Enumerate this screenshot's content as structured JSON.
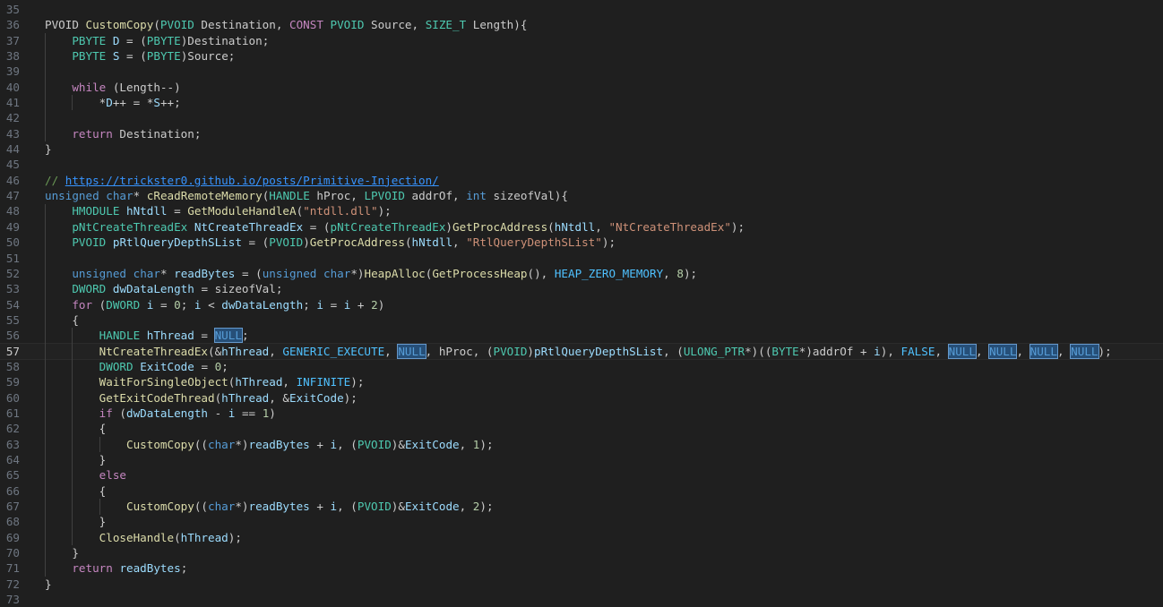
{
  "editor": {
    "first_line": 35,
    "current_line": 57,
    "lines": [
      [],
      [
        [
          "PVOID ",
          "x"
        ],
        [
          "CustomCopy",
          "f"
        ],
        [
          "(",
          "x"
        ],
        [
          "PVOID",
          "t"
        ],
        [
          " Destination, ",
          "x"
        ],
        [
          "CONST",
          "c"
        ],
        [
          " ",
          "x"
        ],
        [
          "PVOID",
          "t"
        ],
        [
          " Source, ",
          "x"
        ],
        [
          "SIZE_T",
          "t"
        ],
        [
          " Length){",
          "x"
        ]
      ],
      [
        [
          "    ",
          "x"
        ],
        [
          "PBYTE",
          "t"
        ],
        [
          " ",
          "x"
        ],
        [
          "D",
          "v"
        ],
        [
          " = (",
          "x"
        ],
        [
          "PBYTE",
          "t"
        ],
        [
          ")Destination;",
          "x"
        ]
      ],
      [
        [
          "    ",
          "x"
        ],
        [
          "PBYTE",
          "t"
        ],
        [
          " ",
          "x"
        ],
        [
          "S",
          "v"
        ],
        [
          " = (",
          "x"
        ],
        [
          "PBYTE",
          "t"
        ],
        [
          ")Source;",
          "x"
        ]
      ],
      [],
      [
        [
          "    ",
          "x"
        ],
        [
          "while",
          "c"
        ],
        [
          " (Length--)",
          "x"
        ]
      ],
      [
        [
          "        *",
          "x"
        ],
        [
          "D",
          "v"
        ],
        [
          "++ = *",
          "x"
        ],
        [
          "S",
          "v"
        ],
        [
          "++;",
          "x"
        ]
      ],
      [],
      [
        [
          "    ",
          "x"
        ],
        [
          "return",
          "c"
        ],
        [
          " Destination;",
          "x"
        ]
      ],
      [
        [
          "}",
          "x"
        ]
      ],
      [],
      [
        [
          "// ",
          "g"
        ],
        [
          "https://trickster0.github.io/posts/Primitive-Injection/",
          "u"
        ]
      ],
      [
        [
          "unsigned",
          "k"
        ],
        [
          " ",
          "x"
        ],
        [
          "char",
          "k"
        ],
        [
          "* ",
          "x"
        ],
        [
          "cReadRemoteMemory",
          "f"
        ],
        [
          "(",
          "x"
        ],
        [
          "HANDLE",
          "t"
        ],
        [
          " hProc, ",
          "x"
        ],
        [
          "LPVOID",
          "t"
        ],
        [
          " addrOf, ",
          "x"
        ],
        [
          "int",
          "k"
        ],
        [
          " sizeofVal){",
          "x"
        ]
      ],
      [
        [
          "    ",
          "x"
        ],
        [
          "HMODULE",
          "t"
        ],
        [
          " ",
          "x"
        ],
        [
          "hNtdll",
          "v"
        ],
        [
          " = ",
          "x"
        ],
        [
          "GetModuleHandleA",
          "f"
        ],
        [
          "(",
          "x"
        ],
        [
          "\"ntdll.dll\"",
          "s"
        ],
        [
          ");",
          "x"
        ]
      ],
      [
        [
          "    ",
          "x"
        ],
        [
          "pNtCreateThreadEx",
          "t"
        ],
        [
          " ",
          "x"
        ],
        [
          "NtCreateThreadEx",
          "v"
        ],
        [
          " = (",
          "x"
        ],
        [
          "pNtCreateThreadEx",
          "t"
        ],
        [
          ")",
          "x"
        ],
        [
          "GetProcAddress",
          "f"
        ],
        [
          "(",
          "x"
        ],
        [
          "hNtdll",
          "v"
        ],
        [
          ", ",
          "x"
        ],
        [
          "\"NtCreateThreadEx\"",
          "s"
        ],
        [
          ");",
          "x"
        ]
      ],
      [
        [
          "    ",
          "x"
        ],
        [
          "PVOID",
          "t"
        ],
        [
          " ",
          "x"
        ],
        [
          "pRtlQueryDepthSList",
          "v"
        ],
        [
          " = (",
          "x"
        ],
        [
          "PVOID",
          "t"
        ],
        [
          ")",
          "x"
        ],
        [
          "GetProcAddress",
          "f"
        ],
        [
          "(",
          "x"
        ],
        [
          "hNtdll",
          "v"
        ],
        [
          ", ",
          "x"
        ],
        [
          "\"RtlQueryDepthSList\"",
          "s"
        ],
        [
          ");",
          "x"
        ]
      ],
      [],
      [
        [
          "    ",
          "x"
        ],
        [
          "unsigned",
          "k"
        ],
        [
          " ",
          "x"
        ],
        [
          "char",
          "k"
        ],
        [
          "* ",
          "x"
        ],
        [
          "readBytes",
          "v"
        ],
        [
          " = (",
          "x"
        ],
        [
          "unsigned",
          "k"
        ],
        [
          " ",
          "x"
        ],
        [
          "char",
          "k"
        ],
        [
          "*)",
          "x"
        ],
        [
          "HeapAlloc",
          "f"
        ],
        [
          "(",
          "x"
        ],
        [
          "GetProcessHeap",
          "f"
        ],
        [
          "(), ",
          "x"
        ],
        [
          "HEAP_ZERO_MEMORY",
          "m"
        ],
        [
          ", ",
          "x"
        ],
        [
          "8",
          "n"
        ],
        [
          ");",
          "x"
        ]
      ],
      [
        [
          "    ",
          "x"
        ],
        [
          "DWORD",
          "t"
        ],
        [
          " ",
          "x"
        ],
        [
          "dwDataLength",
          "v"
        ],
        [
          " = sizeofVal;",
          "x"
        ]
      ],
      [
        [
          "    ",
          "x"
        ],
        [
          "for",
          "c"
        ],
        [
          " (",
          "x"
        ],
        [
          "DWORD",
          "t"
        ],
        [
          " ",
          "x"
        ],
        [
          "i",
          "v"
        ],
        [
          " = ",
          "x"
        ],
        [
          "0",
          "n"
        ],
        [
          "; ",
          "x"
        ],
        [
          "i",
          "v"
        ],
        [
          " < ",
          "x"
        ],
        [
          "dwDataLength",
          "v"
        ],
        [
          "; ",
          "x"
        ],
        [
          "i",
          "v"
        ],
        [
          " = ",
          "x"
        ],
        [
          "i",
          "v"
        ],
        [
          " + ",
          "x"
        ],
        [
          "2",
          "n"
        ],
        [
          ")",
          "x"
        ]
      ],
      [
        [
          "    {",
          "x"
        ]
      ],
      [
        [
          "        ",
          "x"
        ],
        [
          "HANDLE",
          "t"
        ],
        [
          " ",
          "x"
        ],
        [
          "hThread",
          "v"
        ],
        [
          " = ",
          "x"
        ],
        [
          "NULL",
          "h"
        ],
        [
          ";",
          "x"
        ]
      ],
      [
        [
          "        ",
          "x"
        ],
        [
          "NtCreateThreadEx",
          "f"
        ],
        [
          "(&",
          "x"
        ],
        [
          "hThread",
          "v"
        ],
        [
          ", ",
          "x"
        ],
        [
          "GENERIC_EXECUTE",
          "m"
        ],
        [
          ", ",
          "x"
        ],
        [
          "NULL",
          "h"
        ],
        [
          ", hProc, (",
          "x"
        ],
        [
          "PVOID",
          "t"
        ],
        [
          ")",
          "x"
        ],
        [
          "pRtlQueryDepthSList",
          "v"
        ],
        [
          ", (",
          "x"
        ],
        [
          "ULONG_PTR",
          "t"
        ],
        [
          "*)((",
          "x"
        ],
        [
          "BYTE",
          "t"
        ],
        [
          "*)addrOf + ",
          "x"
        ],
        [
          "i",
          "v"
        ],
        [
          "), ",
          "x"
        ],
        [
          "FALSE",
          "m"
        ],
        [
          ", ",
          "x"
        ],
        [
          "NULL",
          "h"
        ],
        [
          ", ",
          "x"
        ],
        [
          "NULL",
          "h"
        ],
        [
          ", ",
          "x"
        ],
        [
          "NULL",
          "h"
        ],
        [
          ", ",
          "x"
        ],
        [
          "NULL",
          "h"
        ],
        [
          ");",
          "x"
        ]
      ],
      [
        [
          "        ",
          "x"
        ],
        [
          "DWORD",
          "t"
        ],
        [
          " ",
          "x"
        ],
        [
          "ExitCode",
          "v"
        ],
        [
          " = ",
          "x"
        ],
        [
          "0",
          "n"
        ],
        [
          ";",
          "x"
        ]
      ],
      [
        [
          "        ",
          "x"
        ],
        [
          "WaitForSingleObject",
          "f"
        ],
        [
          "(",
          "x"
        ],
        [
          "hThread",
          "v"
        ],
        [
          ", ",
          "x"
        ],
        [
          "INFINITE",
          "m"
        ],
        [
          ");",
          "x"
        ]
      ],
      [
        [
          "        ",
          "x"
        ],
        [
          "GetExitCodeThread",
          "f"
        ],
        [
          "(",
          "x"
        ],
        [
          "hThread",
          "v"
        ],
        [
          ", &",
          "x"
        ],
        [
          "ExitCode",
          "v"
        ],
        [
          ");",
          "x"
        ]
      ],
      [
        [
          "        ",
          "x"
        ],
        [
          "if",
          "c"
        ],
        [
          " (",
          "x"
        ],
        [
          "dwDataLength",
          "v"
        ],
        [
          " - ",
          "x"
        ],
        [
          "i",
          "v"
        ],
        [
          " == ",
          "x"
        ],
        [
          "1",
          "n"
        ],
        [
          ")",
          "x"
        ]
      ],
      [
        [
          "        {",
          "x"
        ]
      ],
      [
        [
          "            ",
          "x"
        ],
        [
          "CustomCopy",
          "f"
        ],
        [
          "((",
          "x"
        ],
        [
          "char",
          "k"
        ],
        [
          "*)",
          "x"
        ],
        [
          "readBytes",
          "v"
        ],
        [
          " + ",
          "x"
        ],
        [
          "i",
          "v"
        ],
        [
          ", (",
          "x"
        ],
        [
          "PVOID",
          "t"
        ],
        [
          ")&",
          "x"
        ],
        [
          "ExitCode",
          "v"
        ],
        [
          ", ",
          "x"
        ],
        [
          "1",
          "n"
        ],
        [
          ");",
          "x"
        ]
      ],
      [
        [
          "        }",
          "x"
        ]
      ],
      [
        [
          "        ",
          "x"
        ],
        [
          "else",
          "c"
        ]
      ],
      [
        [
          "        {",
          "x"
        ]
      ],
      [
        [
          "            ",
          "x"
        ],
        [
          "CustomCopy",
          "f"
        ],
        [
          "((",
          "x"
        ],
        [
          "char",
          "k"
        ],
        [
          "*)",
          "x"
        ],
        [
          "readBytes",
          "v"
        ],
        [
          " + ",
          "x"
        ],
        [
          "i",
          "v"
        ],
        [
          ", (",
          "x"
        ],
        [
          "PVOID",
          "t"
        ],
        [
          ")&",
          "x"
        ],
        [
          "ExitCode",
          "v"
        ],
        [
          ", ",
          "x"
        ],
        [
          "2",
          "n"
        ],
        [
          ");",
          "x"
        ]
      ],
      [
        [
          "        }",
          "x"
        ]
      ],
      [
        [
          "        ",
          "x"
        ],
        [
          "CloseHandle",
          "f"
        ],
        [
          "(",
          "x"
        ],
        [
          "hThread",
          "v"
        ],
        [
          ");",
          "x"
        ]
      ],
      [
        [
          "    }",
          "x"
        ]
      ],
      [
        [
          "    ",
          "x"
        ],
        [
          "return",
          "c"
        ],
        [
          " ",
          "x"
        ],
        [
          "readBytes",
          "v"
        ],
        [
          ";",
          "x"
        ]
      ],
      [
        [
          "}",
          "x"
        ]
      ],
      []
    ]
  },
  "colors": {
    "background": "#1f1f1f",
    "current_line": "#222222",
    "line_number": "#6e7681",
    "keyword": "#569cd6",
    "control": "#c586c0",
    "type": "#4ec9b0",
    "function": "#dcdcaa",
    "variable": "#9cdcfe",
    "string": "#ce9178",
    "number": "#b5cea8",
    "macro": "#4fc1ff",
    "comment": "#6a9955",
    "link": "#3794ff",
    "highlight": "#264f78"
  }
}
